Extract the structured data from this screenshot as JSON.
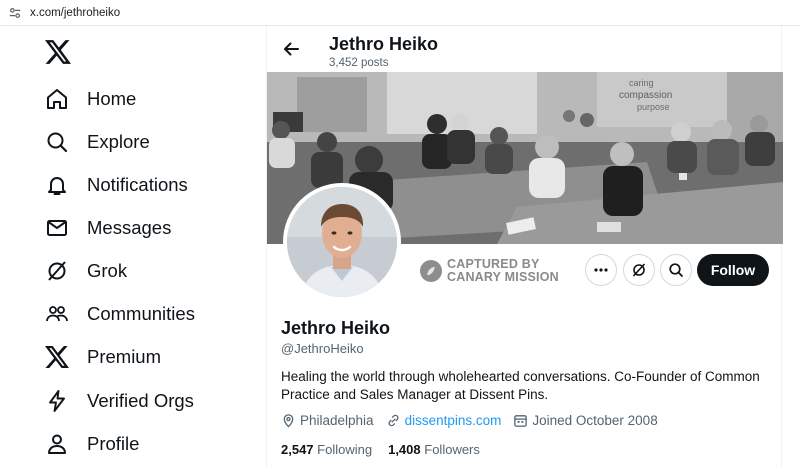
{
  "browser": {
    "url": "x.com/jethroheiko"
  },
  "nav": {
    "items": [
      {
        "label": "Home",
        "icon": "home-icon"
      },
      {
        "label": "Explore",
        "icon": "search-icon"
      },
      {
        "label": "Notifications",
        "icon": "bell-icon"
      },
      {
        "label": "Messages",
        "icon": "envelope-icon"
      },
      {
        "label": "Grok",
        "icon": "grok-icon"
      },
      {
        "label": "Communities",
        "icon": "people-icon"
      },
      {
        "label": "Premium",
        "icon": "x-logo-icon"
      },
      {
        "label": "Verified Orgs",
        "icon": "lightning-icon"
      },
      {
        "label": "Profile",
        "icon": "person-icon"
      }
    ]
  },
  "header": {
    "name": "Jethro Heiko",
    "posts": "3,452 posts"
  },
  "banner": {
    "watermark_words": [
      "caring",
      "compassion",
      "purpose"
    ]
  },
  "stamp": {
    "line1": "CAPTURED BY",
    "line2": "CANARY MISSION"
  },
  "actions": {
    "follow_label": "Follow"
  },
  "profile": {
    "name": "Jethro Heiko",
    "handle": "@JethroHeiko",
    "bio": "Healing the world through wholehearted conversations. Co-Founder of Common Practice and Sales Manager at Dissent Pins.",
    "location": "Philadelphia",
    "website": "dissentpins.com",
    "joined": "Joined October 2008"
  },
  "stats": {
    "following_count": "2,547",
    "following_label": "Following",
    "followers_count": "1,408",
    "followers_label": "Followers"
  },
  "colors": {
    "link": "#1d9bf0",
    "text": "#0f1419",
    "muted": "#536471",
    "follow_bg": "#0f1419"
  }
}
